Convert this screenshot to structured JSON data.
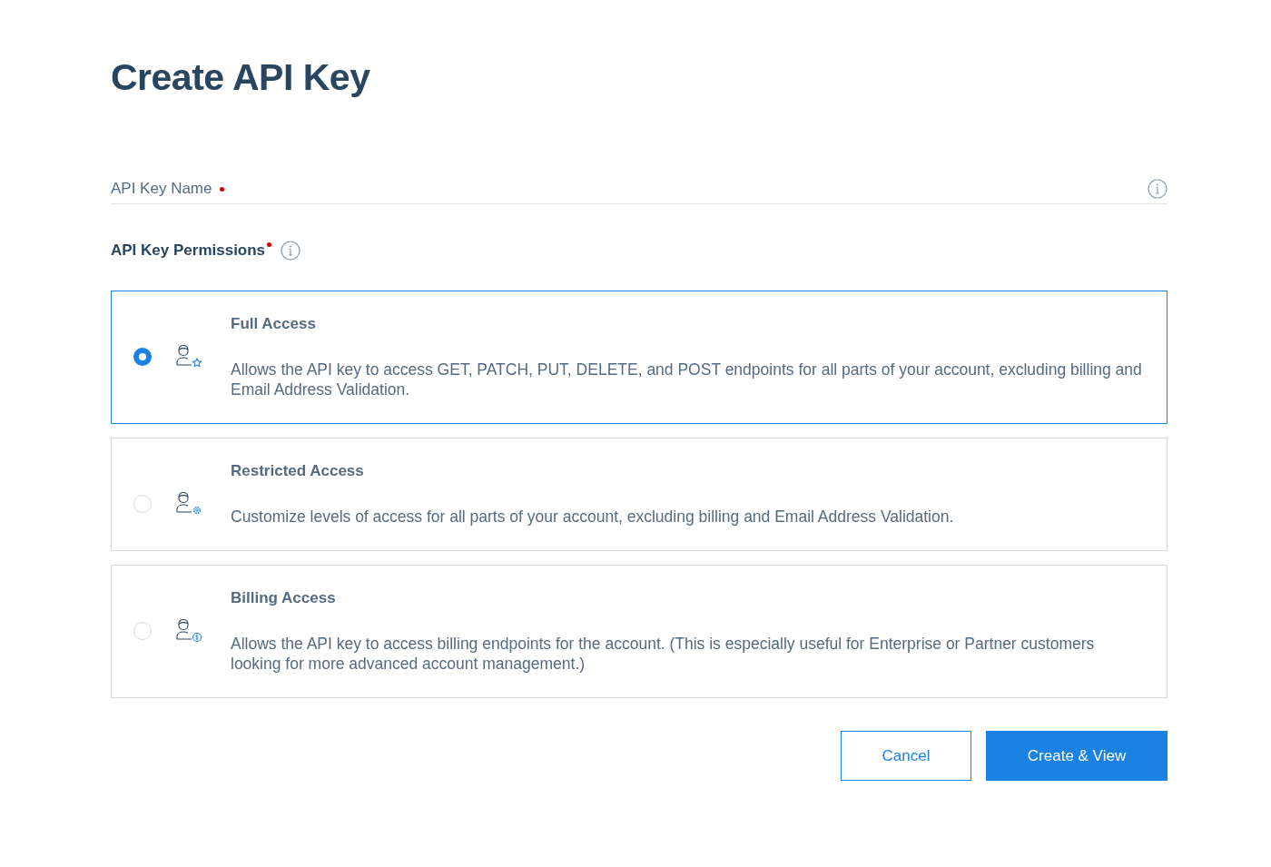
{
  "title": "Create API Key",
  "name_field": {
    "label": "API Key Name",
    "required": true
  },
  "permissions": {
    "label": "API Key Permissions",
    "required": true,
    "options": [
      {
        "kind": "star",
        "title": "Full Access",
        "description": "Allows the API key to access GET, PATCH, PUT, DELETE, and POST endpoints for all parts of your account, excluding billing and Email Address Validation.",
        "selected": true
      },
      {
        "kind": "gear",
        "title": "Restricted Access",
        "description": "Customize levels of access for all parts of your account, excluding billing and Email Address Validation.",
        "selected": false
      },
      {
        "kind": "dollar",
        "title": "Billing Access",
        "description": "Allows the API key to access billing endpoints for the account. (This is especially useful for Enterprise or Partner customers looking for more advanced account management.)",
        "selected": false
      }
    ]
  },
  "buttons": [
    {
      "kind": "secondary",
      "label": "Cancel"
    },
    {
      "kind": "primary",
      "label": "Create & View"
    }
  ]
}
